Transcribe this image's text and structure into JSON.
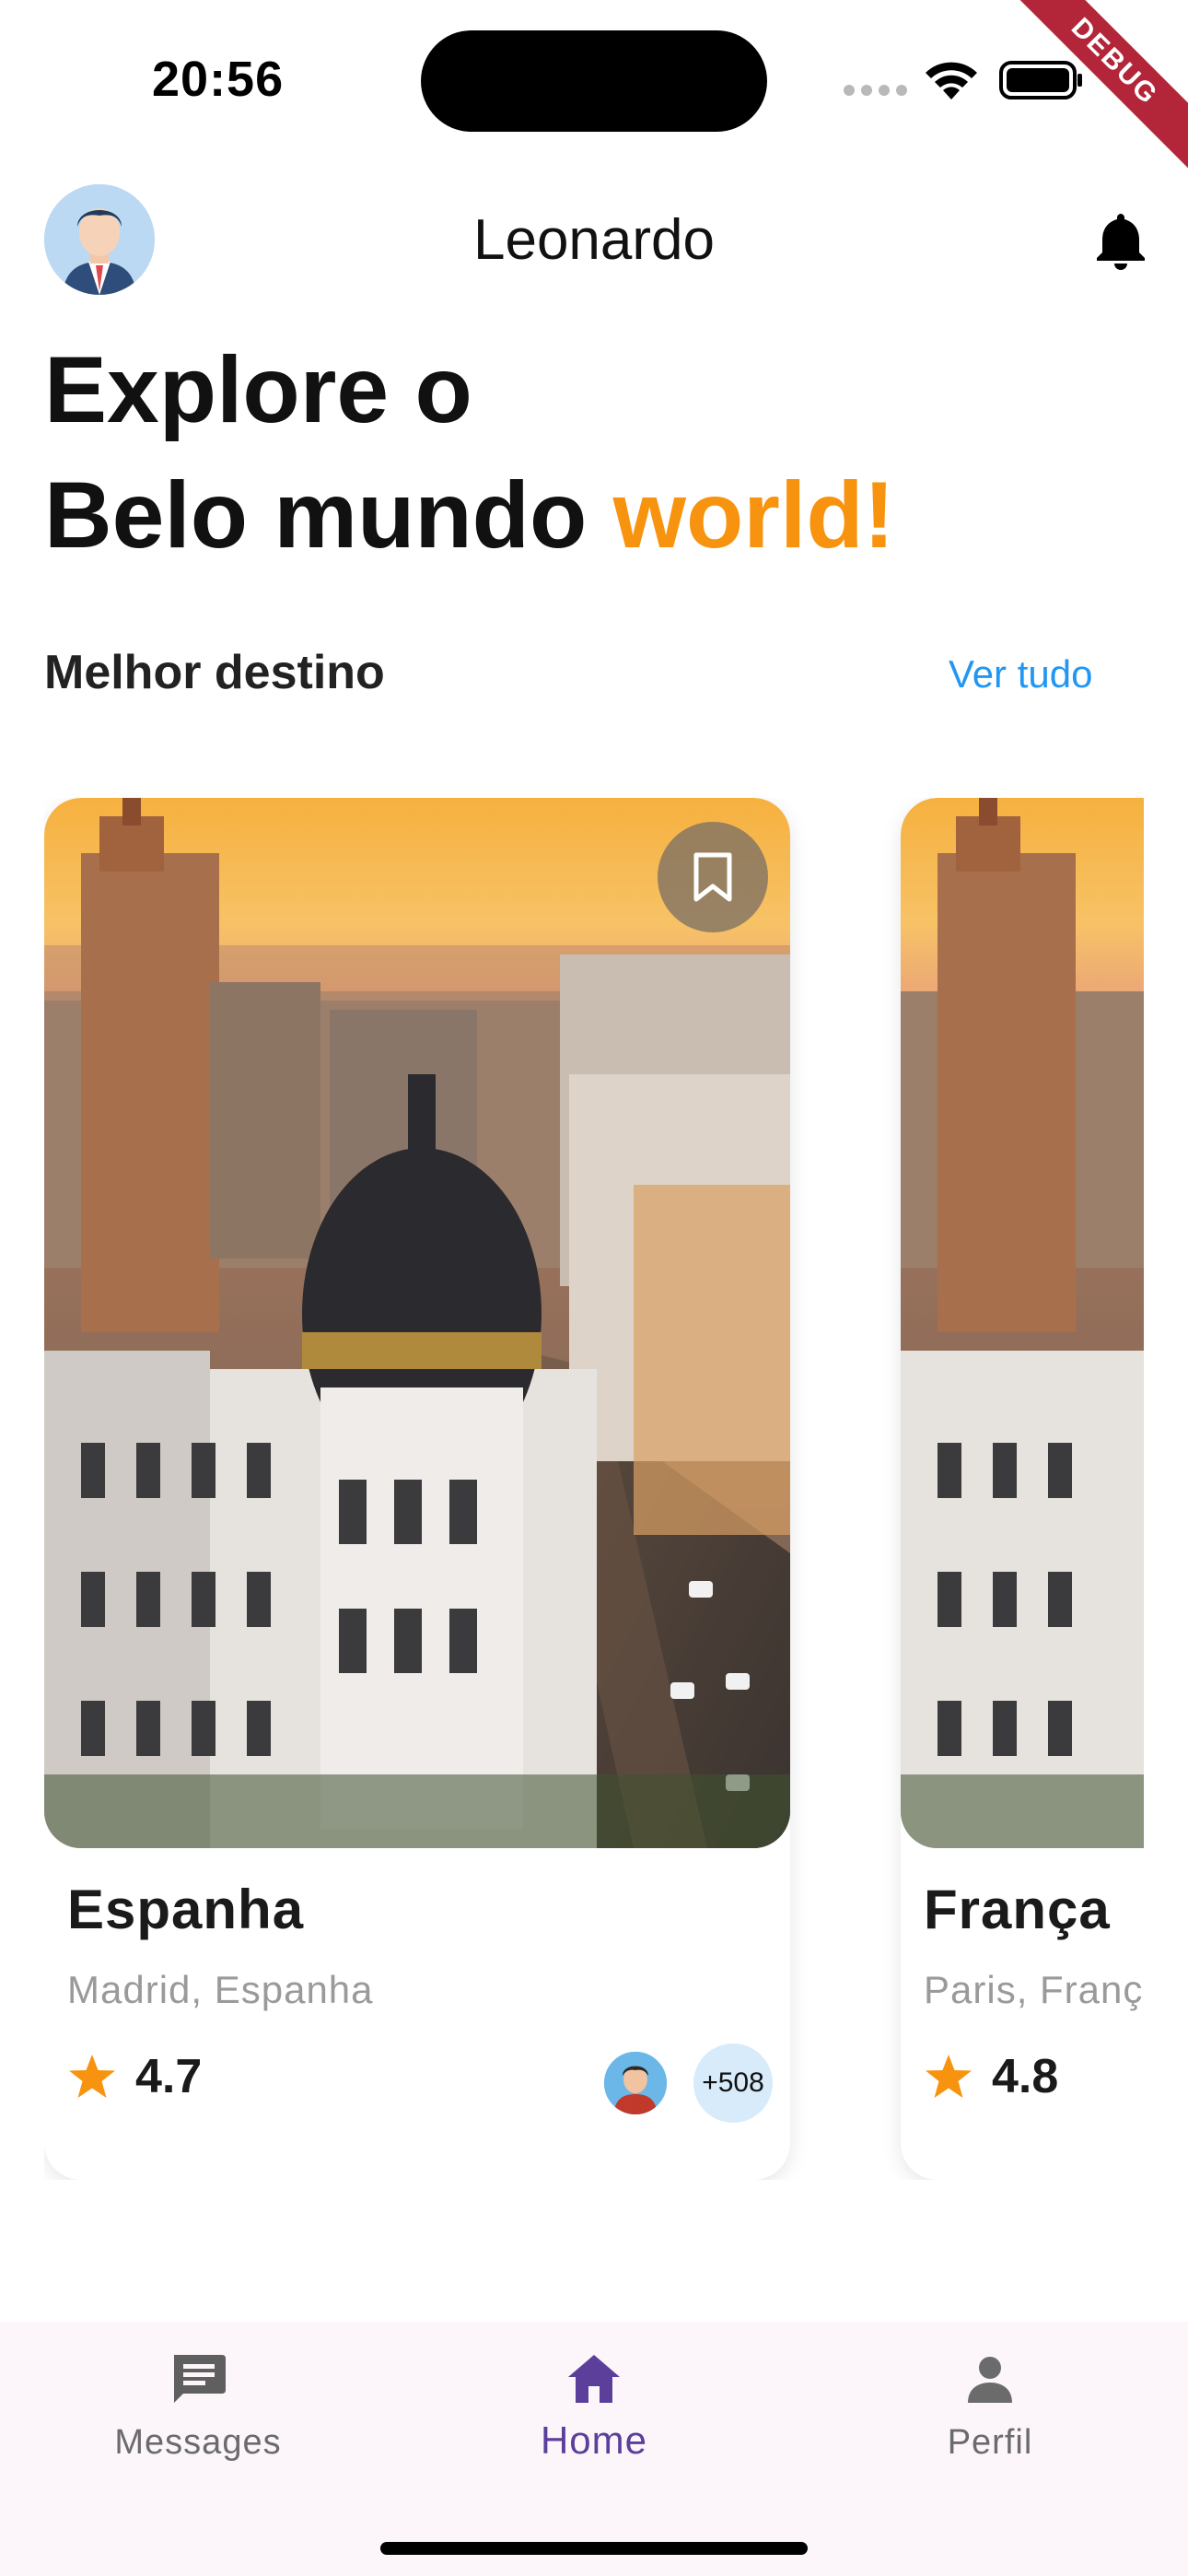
{
  "status_bar": {
    "time": "20:56",
    "debug_label": "DEBUG"
  },
  "header": {
    "username": "Leonardo"
  },
  "headline": {
    "line1": "Explore o",
    "line2_prefix": "Belo mundo",
    "line2_accent": "world!"
  },
  "section": {
    "title": "Melhor destino",
    "see_all": "Ver tudo"
  },
  "cards": [
    {
      "title": "Espanha",
      "subtitle": "Madrid, Espanha",
      "rating": "4.7",
      "visitors": "+508"
    },
    {
      "title": "França",
      "subtitle": "Paris, Franç",
      "rating": "4.8"
    }
  ],
  "nav": {
    "messages": "Messages",
    "home": "Home",
    "profile": "Perfil"
  },
  "colors": {
    "accent": "#f7930e",
    "link": "#2196f3",
    "nav_active": "#5b3f9a",
    "star": "#f7930e"
  },
  "icons": [
    "avatar",
    "bell-icon",
    "bookmark-icon",
    "star-icon",
    "message-icon",
    "home-icon",
    "person-icon",
    "wifi-icon",
    "battery-icon"
  ]
}
